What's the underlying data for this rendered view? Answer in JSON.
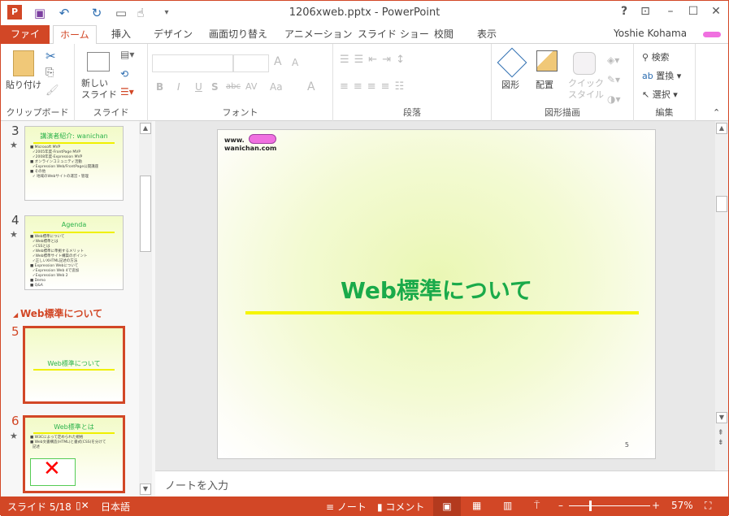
{
  "window": {
    "title": "1206xweb.pptx - PowerPoint",
    "help": "?",
    "restore_ribbon": "⊡",
    "minimize": "–",
    "maximize": "☐",
    "close": "✕"
  },
  "qat": {
    "app_icon": "powerpoint-icon",
    "save_icon": "save-icon",
    "undo_icon": "undo-icon",
    "redo_icon": "repeat-icon",
    "present_icon": "present-icon",
    "touch_icon": "touch-mode-icon",
    "customize": "customize-qat-icon"
  },
  "tabs": [
    "ファイル",
    "ホーム",
    "挿入",
    "デザイン",
    "画面切り替え",
    "アニメーション",
    "スライド ショー",
    "校閲",
    "表示"
  ],
  "active_tab": "ホーム",
  "user": {
    "name": "Yoshie Kohama"
  },
  "ribbon": {
    "clipboard": {
      "label": "クリップボード",
      "paste": "貼り付け"
    },
    "slides": {
      "label": "スライド",
      "new_slide": "新しい\nスライド"
    },
    "font": {
      "label": "フォント",
      "font_name": "",
      "font_size": "",
      "bold": "B",
      "italic": "I",
      "underline": "U",
      "shadow": "S",
      "strike": "abc",
      "spacing": "AV",
      "case": "Aa",
      "color": "A",
      "grow": "A",
      "shrink": "A"
    },
    "paragraph": {
      "label": "段落"
    },
    "drawing": {
      "label": "図形描画",
      "shapes": "図形",
      "arrange": "配置",
      "quick_styles": "クイック\nスタイル"
    },
    "editing": {
      "label": "編集",
      "find": "検索",
      "replace": "置換",
      "select": "選択"
    }
  },
  "slides_pane": {
    "section": "Web標準について",
    "slides": [
      {
        "num": "3",
        "title": "講演者紹介: wanichan",
        "star": true,
        "lines": "■ Microsoft MVP\n  ✓2005年度-FrontPage MVP\n  ✓2008年度-Expression MVP\n■ オンラインコミュニティ活動\n  ✓Expression Web/FrontPage公開講座\n■ その他\n  ✓ 地域のWebサイトの運営・管理"
      },
      {
        "num": "4",
        "title": "Agenda",
        "star": true,
        "lines": "■ Web標準について\n  ✓Web標準とは\n  ✓CSSとは\n  ✓Web標準に準拠するメリット\n  ✓Web標準サイト構築のポイント\n  ✓正しいXHTML記述の方法\n■ Expression Webについて\n  ✓Expression Web 4で追加\n  ✓Expression Web 2\n■ Demo\n■ Q&A"
      },
      {
        "num": "5",
        "title": "Web標準について",
        "star": false,
        "selected": true
      },
      {
        "num": "6",
        "title": "Web標準とは",
        "star": true,
        "lines": "■ W3Cによって定められた規格\n■ Web文書構造(HTML)と書式(CSS)を分けて\n  記述"
      }
    ]
  },
  "slide": {
    "logo_text": "www.\nwanichan.com",
    "title": "Web標準について",
    "number": "5",
    "title_color": "#1aaa4a",
    "rule_color": "#f5f500"
  },
  "notes": {
    "placeholder": "ノートを入力"
  },
  "status": {
    "slide": "スライド 5/18",
    "language": "日本語",
    "notes": "ノート",
    "comments": "コメント",
    "zoom": "57%",
    "zoom_value": 57
  },
  "colors": {
    "accent": "#d24726"
  }
}
